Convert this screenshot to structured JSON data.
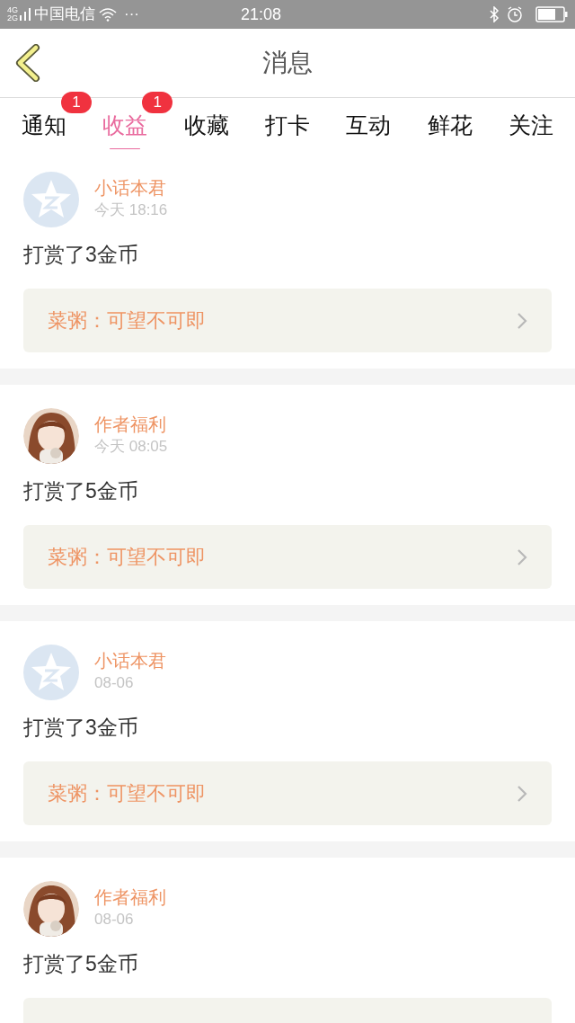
{
  "status_bar": {
    "network_top": "4G",
    "network_bottom": "2G",
    "carrier": "中国电信",
    "more": "···",
    "time": "21:08"
  },
  "header": {
    "title": "消息"
  },
  "tabs": [
    {
      "label": "通知",
      "selected": false,
      "badge": "1"
    },
    {
      "label": "收益",
      "selected": true,
      "badge": "1"
    },
    {
      "label": "收藏",
      "selected": false
    },
    {
      "label": "打卡",
      "selected": false
    },
    {
      "label": "互动",
      "selected": false
    },
    {
      "label": "鲜花",
      "selected": false
    },
    {
      "label": "关注",
      "selected": false
    }
  ],
  "messages": [
    {
      "avatar": {
        "kind": "default"
      },
      "name": "小话本君",
      "time": "今天 18:16",
      "text": "打赏了3金币",
      "link": "菜粥：可望不可即"
    },
    {
      "name": "作者福利",
      "time": "今天 08:05",
      "text": "打赏了5金币",
      "link": "菜粥：可望不可即"
    },
    {
      "avatar": {
        "kind": "default"
      },
      "name": "小话本君",
      "time": "08-06",
      "text": "打赏了3金币",
      "link": "菜粥：可望不可即"
    },
    {
      "name": "作者福利",
      "time": "08-06",
      "text": "打赏了5金币"
    }
  ]
}
